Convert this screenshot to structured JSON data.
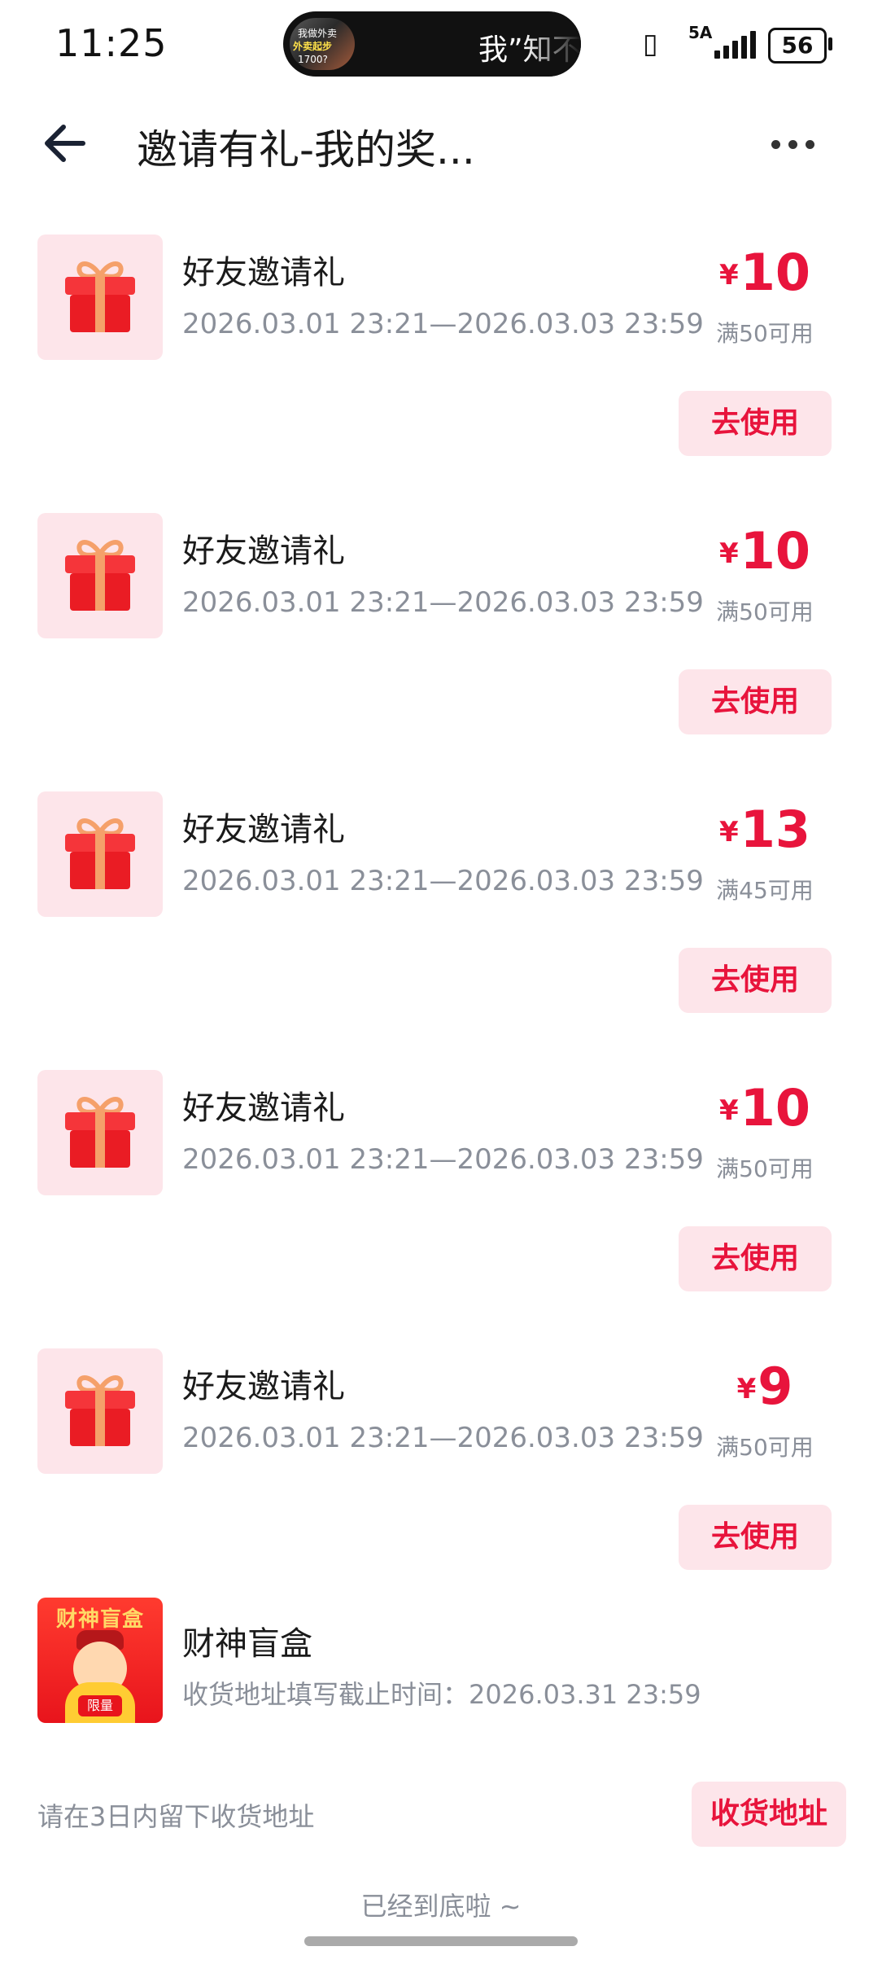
{
  "status_bar": {
    "time": "11:25",
    "media_pill_text": "我”知不",
    "thumb_lines": [
      "我做外卖",
      "外卖起步",
      "1700?"
    ],
    "network": "5A",
    "battery": "56"
  },
  "header": {
    "title": "邀请有礼-我的奖..."
  },
  "coupons": [
    {
      "name": "好友邀请礼",
      "validity": "2026.03.01 23:21—2026.03.03 23:59",
      "currency": "¥",
      "amount": "10",
      "condition": "满50可用",
      "button": "去使用"
    },
    {
      "name": "好友邀请礼",
      "validity": "2026.03.01 23:21—2026.03.03 23:59",
      "currency": "¥",
      "amount": "10",
      "condition": "满50可用",
      "button": "去使用"
    },
    {
      "name": "好友邀请礼",
      "validity": "2026.03.01 23:21—2026.03.03 23:59",
      "currency": "¥",
      "amount": "13",
      "condition": "满45可用",
      "button": "去使用"
    },
    {
      "name": "好友邀请礼",
      "validity": "2026.03.01 23:21—2026.03.03 23:59",
      "currency": "¥",
      "amount": "10",
      "condition": "满50可用",
      "button": "去使用"
    },
    {
      "name": "好友邀请礼",
      "validity": "2026.03.01 23:21—2026.03.03 23:59",
      "currency": "¥",
      "amount": "9",
      "condition": "满50可用",
      "button": "去使用"
    }
  ],
  "blind_box": {
    "image_title": "财神盲盒",
    "image_tag": "限量",
    "name": "财神盲盒",
    "deadline": "收货地址填写截止时间：2026.03.31 23:59",
    "note": "请在3日内留下收货地址",
    "button": "收货地址"
  },
  "footer": {
    "end_text": "已经到底啦 ~"
  },
  "colors": {
    "accent": "#e8143c",
    "button_bg": "#fde5ea",
    "muted_text": "#8a8f99"
  },
  "icons": [
    "back-arrow-icon",
    "more-dots-icon",
    "gift-icon",
    "vibrate-icon",
    "signal-icon",
    "battery-icon"
  ]
}
